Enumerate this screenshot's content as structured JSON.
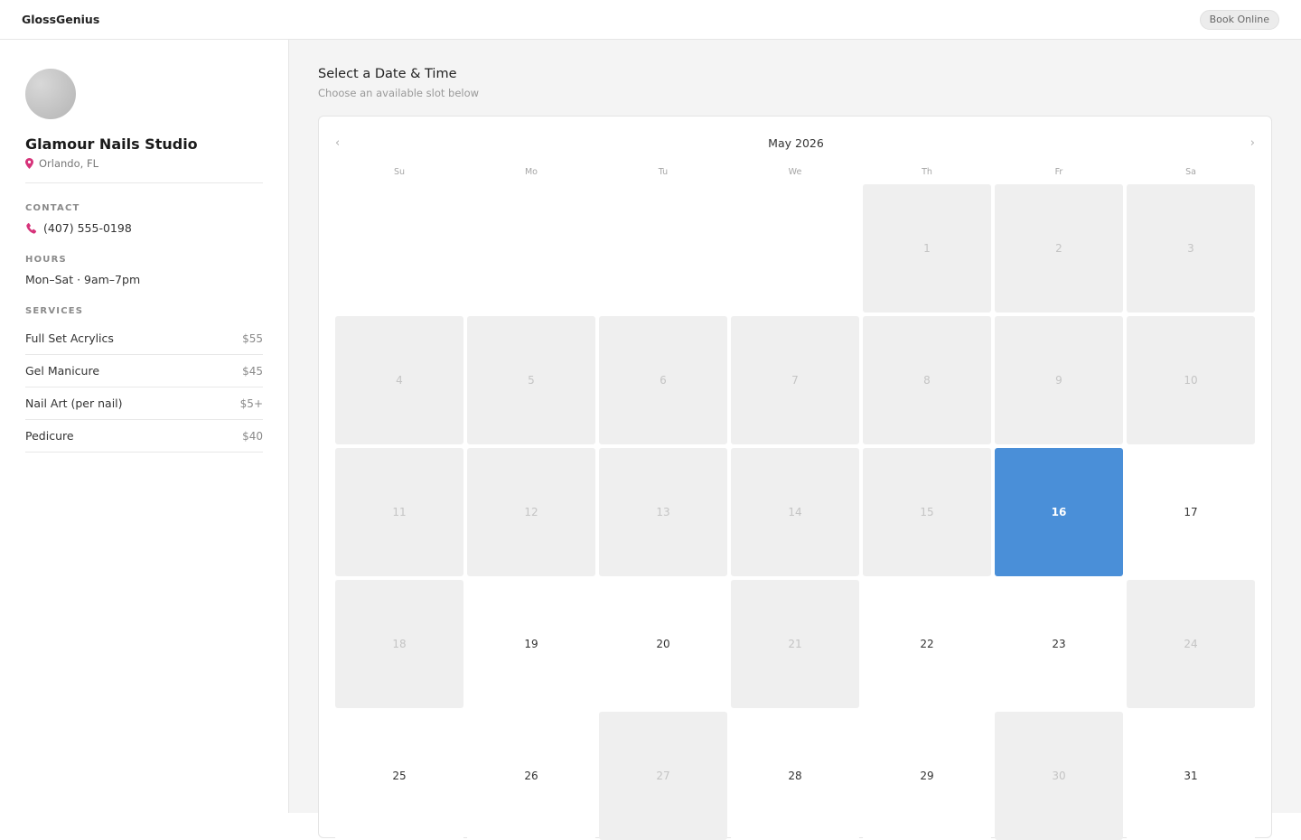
{
  "header": {
    "brand": "GlossGenius",
    "book_label": "Book Online"
  },
  "sidebar": {
    "business_name": "Glamour Nails Studio",
    "location": "Orlando, FL",
    "contact_label": "CONTACT",
    "phone": "(407) 555-0198",
    "hours_label": "HOURS",
    "hours": "Mon–Sat · 9am–7pm",
    "services_label": "SERVICES",
    "services": [
      {
        "name": "Full Set Acrylics",
        "price": "$55"
      },
      {
        "name": "Gel Manicure",
        "price": "$45"
      },
      {
        "name": "Nail Art (per nail)",
        "price": "$5+"
      },
      {
        "name": "Pedicure",
        "price": "$40"
      }
    ],
    "accent_color": "#d6337a"
  },
  "main": {
    "title": "Select a Date & Time",
    "subtitle": "Choose an available slot below"
  },
  "calendar": {
    "month_label": "May 2026",
    "prev_icon": "‹",
    "next_icon": "›",
    "weekdays": [
      "Su",
      "Mo",
      "Tu",
      "We",
      "Th",
      "Fr",
      "Sa"
    ],
    "leading_empty": 4,
    "selected_color": "#4a8fd8",
    "days": [
      {
        "d": "1",
        "state": "unavailable"
      },
      {
        "d": "2",
        "state": "unavailable"
      },
      {
        "d": "3",
        "state": "unavailable"
      },
      {
        "d": "4",
        "state": "unavailable"
      },
      {
        "d": "5",
        "state": "unavailable"
      },
      {
        "d": "6",
        "state": "unavailable"
      },
      {
        "d": "7",
        "state": "unavailable"
      },
      {
        "d": "8",
        "state": "unavailable"
      },
      {
        "d": "9",
        "state": "unavailable"
      },
      {
        "d": "10",
        "state": "unavailable"
      },
      {
        "d": "11",
        "state": "unavailable"
      },
      {
        "d": "12",
        "state": "unavailable"
      },
      {
        "d": "13",
        "state": "unavailable"
      },
      {
        "d": "14",
        "state": "unavailable"
      },
      {
        "d": "15",
        "state": "unavailable"
      },
      {
        "d": "16",
        "state": "selected"
      },
      {
        "d": "17",
        "state": "available"
      },
      {
        "d": "18",
        "state": "unavailable"
      },
      {
        "d": "19",
        "state": "available"
      },
      {
        "d": "20",
        "state": "available"
      },
      {
        "d": "21",
        "state": "unavailable"
      },
      {
        "d": "22",
        "state": "available"
      },
      {
        "d": "23",
        "state": "available"
      },
      {
        "d": "24",
        "state": "unavailable"
      },
      {
        "d": "25",
        "state": "available"
      },
      {
        "d": "26",
        "state": "available"
      },
      {
        "d": "27",
        "state": "unavailable"
      },
      {
        "d": "28",
        "state": "available"
      },
      {
        "d": "29",
        "state": "available"
      },
      {
        "d": "30",
        "state": "unavailable"
      },
      {
        "d": "31",
        "state": "available"
      }
    ]
  }
}
